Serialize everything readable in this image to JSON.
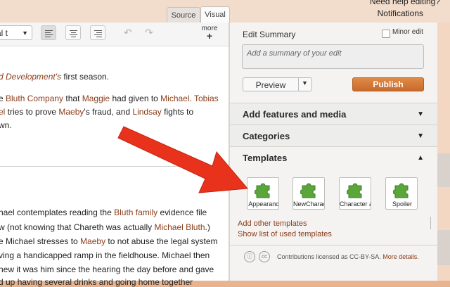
{
  "top": {
    "help_text": "Need help editing?",
    "notifications": "Notifications",
    "tab_source": "Source",
    "tab_visual": "Visual"
  },
  "toolbar": {
    "format_value": "al t",
    "more_label": "more",
    "more_plus": "+"
  },
  "article": {
    "line1": {
      "a": "d Development's",
      "b": " first season."
    },
    "line2": {
      "a": "e ",
      "b": "Bluth Company",
      "c": " that ",
      "d": "Maggie",
      "e": " had given to ",
      "f": "Michael",
      "g": ". ",
      "h": "Tobias"
    },
    "line3": {
      "a": "el",
      "b": " tries to prove ",
      "c": "Maeby",
      "d": "'s fraud, and ",
      "e": "Lindsay",
      "f": " fights to"
    },
    "line4": "wn.",
    "line5": {
      "a": "hael contemplates reading the ",
      "b": "Bluth family",
      "c": " evidence file"
    },
    "line6": {
      "a": "w (not knowing that Chareth was actually ",
      "b": "Michael Bluth",
      "c": ".)"
    },
    "line7": {
      "a": "e Michael stresses to ",
      "b": "Maeby",
      "c": " to not abuse the legal system"
    },
    "line8": "ving a handicapped ramp in the fieldhouse. Michael then",
    "line9": "new it was him since the hearing the day before and gave",
    "line10": "d up having several drinks and going home together"
  },
  "panel": {
    "edit_summary_label": "Edit Summary",
    "minor_edit_label": "Minor edit",
    "summary_placeholder": "Add a summary of your edit",
    "preview_label": "Preview",
    "publish_label": "Publish",
    "sections": [
      {
        "title": "Add features and media",
        "state": "collapsed"
      },
      {
        "title": "Categories",
        "state": "collapsed"
      },
      {
        "title": "Templates",
        "state": "expanded"
      }
    ],
    "templates": [
      "Appearanc",
      "NewCharac",
      "Character a",
      "Spoiler"
    ],
    "add_other_templates": "Add other templates",
    "show_list": "Show list of used templates",
    "license_text": "Contributions licensed as CC-BY-SA.",
    "more_details": "More details.",
    "cc_label": "cc"
  },
  "colors": {
    "accent": "#d9782f",
    "link": "#8b3d1a",
    "arrow": "#e8321c",
    "puzzle": "#5aa63a"
  }
}
